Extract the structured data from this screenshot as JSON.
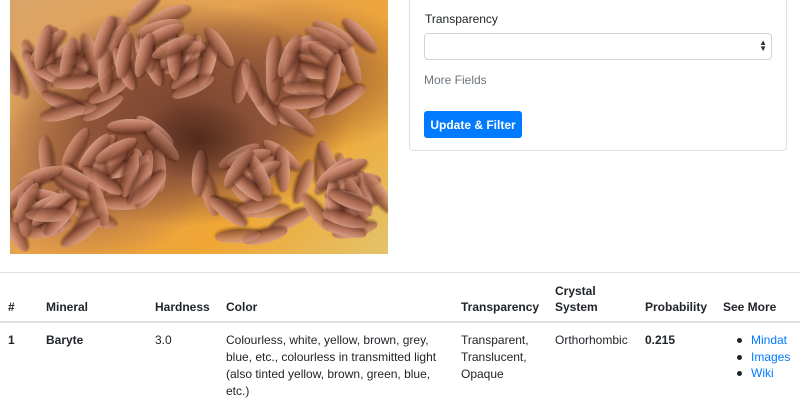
{
  "filters": {
    "transparency_label": "Transparency",
    "transparency_value": "",
    "more_fields_label": "More Fields",
    "update_button_label": "Update & Filter"
  },
  "table": {
    "headers": {
      "rank": "#",
      "mineral": "Mineral",
      "hardness": "Hardness",
      "color": "Color",
      "transparency": "Transparency",
      "crystal_system": "Crystal System",
      "probability": "Probability",
      "see_more": "See More"
    },
    "rows": [
      {
        "rank": "1",
        "mineral": "Baryte",
        "hardness": "3.0",
        "color": "Colourless, white, yellow, brown, grey, blue, etc., colourless in transmitted light (also tinted yellow, brown, green, blue, etc.)",
        "transparency": "Transparent, Translucent, Opaque",
        "crystal_system": "Orthorhombic",
        "probability": "0.215",
        "links": [
          "Mindat",
          "Images",
          "Wiki"
        ]
      }
    ]
  },
  "colors": {
    "primary": "#007bff",
    "border": "#dee2e6",
    "muted_text": "#6c757d"
  }
}
